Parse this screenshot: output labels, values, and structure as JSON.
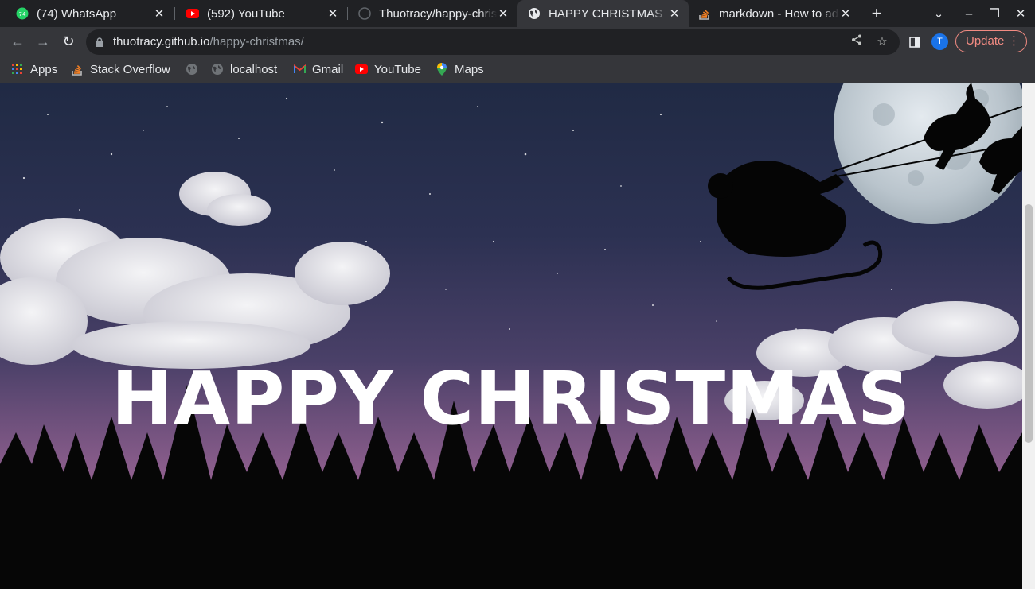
{
  "tabs": [
    {
      "title": "(74) WhatsApp",
      "icon": "whatsapp-icon"
    },
    {
      "title": "(592) YouTube",
      "icon": "youtube-icon"
    },
    {
      "title": "Thuotracy/happy-christmas",
      "icon": "github-icon"
    },
    {
      "title": "HAPPY CHRISTMAS",
      "icon": "globe-icon",
      "active": true
    },
    {
      "title": "markdown - How to add",
      "icon": "stackoverflow-icon"
    }
  ],
  "address": {
    "host": "thuotracy.github.io",
    "path": "/happy-christmas/"
  },
  "profile_initial": "T",
  "update_label": "Update",
  "bookmarks": [
    {
      "label": "Apps",
      "icon": "apps-grid-icon"
    },
    {
      "label": "Stack Overflow",
      "icon": "stackoverflow-icon"
    },
    {
      "label": "",
      "icon": "globe-icon"
    },
    {
      "label": "localhost",
      "icon": "globe-icon"
    },
    {
      "label": "Gmail",
      "icon": "gmail-icon"
    },
    {
      "label": "YouTube",
      "icon": "youtube-icon"
    },
    {
      "label": "Maps",
      "icon": "maps-icon"
    }
  ],
  "hero_text": "HAPPY CHRISTMAS",
  "colors": {
    "whatsapp": "#25d366",
    "youtube": "#ff0000",
    "update": "#f28b82",
    "avatar": "#1a73e8"
  }
}
